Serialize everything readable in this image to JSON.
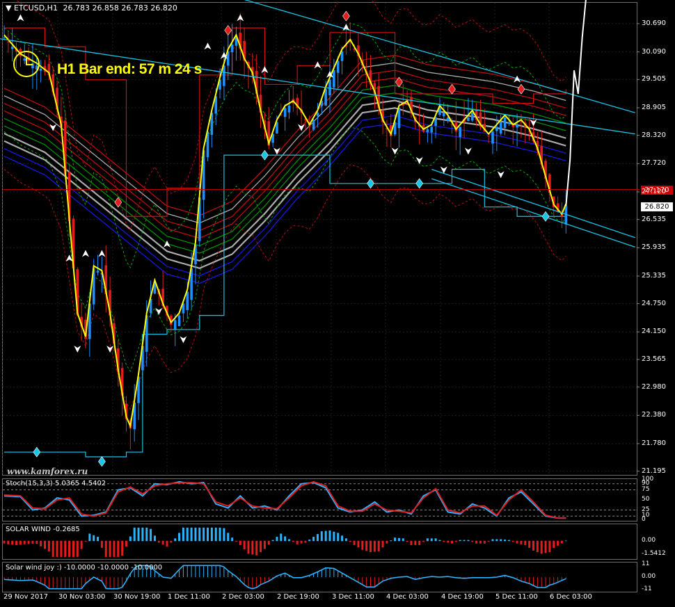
{
  "header": {
    "symbol_label": "ETCUSD,H1",
    "ohlc": "26.783 26.858 26.783 26.820"
  },
  "timer_text": "H1 Bar end: 57 m 24 s",
  "watermark": "www.kamforex.ru",
  "price_boxes": {
    "hline_price": "27.170",
    "current_price": "26.820"
  },
  "colors": {
    "background": "#000000",
    "bull": "#1e90ff",
    "bear": "#e41c1c",
    "signal_line": "#ffff00",
    "channel": "#19c6e6",
    "hline": "#cc0000",
    "ema_band": [
      "#1a1aff",
      "#c0c0c0",
      "#00a000",
      "#d01010"
    ]
  },
  "chart_data": [
    {
      "type": "candlestick",
      "title": "ETCUSD,H1",
      "y_ticks": [
        "30.690",
        "30.090",
        "29.505",
        "28.905",
        "28.320",
        "27.720",
        "27.120",
        "26.535",
        "25.935",
        "25.335",
        "24.750",
        "24.150",
        "23.565",
        "22.980",
        "22.380",
        "21.780",
        "21.195"
      ],
      "x_ticks": [
        "29 Nov 2017",
        "30 Nov 03:00",
        "30 Nov 19:00",
        "1 Dec 11:00",
        "2 Dec 03:00",
        "2 Dec 19:00",
        "3 Dec 11:00",
        "4 Dec 03:00",
        "4 Dec 19:00",
        "5 Dec 11:00",
        "6 Dec 03:00"
      ],
      "ylim": [
        21.0,
        31.0
      ],
      "close_path": [
        [
          0,
          30.4
        ],
        [
          4,
          30.0
        ],
        [
          8,
          29.8
        ],
        [
          11,
          29.6
        ],
        [
          14,
          28.5
        ],
        [
          16,
          26.5
        ],
        [
          18,
          24.5
        ],
        [
          20,
          24.0
        ],
        [
          22,
          25.5
        ],
        [
          24,
          25.4
        ],
        [
          26,
          24.5
        ],
        [
          28,
          23.3
        ],
        [
          30,
          22.3
        ],
        [
          31,
          22.1
        ],
        [
          33,
          23.2
        ],
        [
          35,
          24.5
        ],
        [
          37,
          25.2
        ],
        [
          39,
          24.7
        ],
        [
          41,
          24.3
        ],
        [
          43,
          24.5
        ],
        [
          45,
          25.0
        ],
        [
          47,
          26.0
        ],
        [
          49,
          28.0
        ],
        [
          51,
          28.8
        ],
        [
          53,
          29.5
        ],
        [
          55,
          30.1
        ],
        [
          57,
          30.4
        ],
        [
          59,
          29.9
        ],
        [
          61,
          29.6
        ],
        [
          63,
          28.8
        ],
        [
          65,
          28.1
        ],
        [
          67,
          28.6
        ],
        [
          69,
          28.9
        ],
        [
          71,
          29.0
        ],
        [
          73,
          28.8
        ],
        [
          75,
          28.5
        ],
        [
          77,
          28.8
        ],
        [
          79,
          29.3
        ],
        [
          81,
          29.7
        ],
        [
          83,
          30.1
        ],
        [
          85,
          30.3
        ],
        [
          87,
          30.0
        ],
        [
          89,
          29.6
        ],
        [
          91,
          29.2
        ],
        [
          93,
          28.6
        ],
        [
          95,
          28.3
        ],
        [
          97,
          28.9
        ],
        [
          99,
          29.0
        ],
        [
          101,
          28.6
        ],
        [
          103,
          28.4
        ],
        [
          105,
          28.5
        ],
        [
          107,
          28.9
        ],
        [
          109,
          28.7
        ],
        [
          111,
          28.4
        ],
        [
          113,
          28.6
        ],
        [
          115,
          28.8
        ],
        [
          117,
          28.5
        ],
        [
          119,
          28.3
        ],
        [
          121,
          28.5
        ],
        [
          123,
          28.7
        ],
        [
          125,
          28.5
        ],
        [
          127,
          28.6
        ],
        [
          129,
          28.4
        ],
        [
          131,
          28.0
        ],
        [
          133,
          27.4
        ],
        [
          135,
          26.8
        ],
        [
          137,
          26.6
        ],
        [
          138,
          26.82
        ]
      ],
      "ema_band_levels": [
        [
          0,
          28.6
        ],
        [
          10,
          28.2
        ],
        [
          20,
          27.5
        ],
        [
          30,
          26.8
        ],
        [
          40,
          26.1
        ],
        [
          48,
          25.9
        ],
        [
          56,
          26.2
        ],
        [
          64,
          26.9
        ],
        [
          72,
          27.7
        ],
        [
          80,
          28.4
        ],
        [
          88,
          29.2
        ],
        [
          96,
          29.3
        ],
        [
          104,
          29.1
        ],
        [
          112,
          29.0
        ],
        [
          120,
          28.9
        ],
        [
          130,
          28.7
        ],
        [
          138,
          28.5
        ]
      ],
      "channel_lines": [
        {
          "from": [
            -15,
            30.55
          ],
          "to": [
            155,
            28.35
          ]
        },
        {
          "from": [
            55,
            31.3
          ],
          "to": [
            155,
            28.8
          ]
        },
        {
          "from": [
            105,
            27.6
          ],
          "to": [
            155,
            26.15
          ]
        },
        {
          "from": [
            105,
            27.4
          ],
          "to": [
            155,
            25.95
          ]
        }
      ],
      "hline": 27.17,
      "projection": [
        [
          138,
          26.82
        ],
        [
          139,
          27.8
        ],
        [
          140,
          29.7
        ],
        [
          141,
          29.2
        ],
        [
          142,
          30.4
        ],
        [
          143,
          31.3
        ]
      ],
      "levels_upper": [
        [
          0,
          30.6
        ],
        [
          10,
          30.2
        ],
        [
          20,
          29.5
        ],
        [
          30,
          26.6
        ],
        [
          40,
          27.2
        ],
        [
          48,
          29.6
        ],
        [
          56,
          30.6
        ],
        [
          64,
          29.4
        ],
        [
          72,
          29.8
        ],
        [
          80,
          30.5
        ],
        [
          88,
          30.5
        ],
        [
          96,
          29.2
        ],
        [
          110,
          29.2
        ],
        [
          120,
          29.0
        ],
        [
          130,
          29.2
        ],
        [
          138,
          29.3
        ]
      ],
      "levels_lower": [
        [
          0,
          21.6
        ],
        [
          10,
          21.6
        ],
        [
          20,
          21.5
        ],
        [
          30,
          21.6
        ],
        [
          34,
          24.1
        ],
        [
          40,
          24.2
        ],
        [
          48,
          24.5
        ],
        [
          54,
          27.9
        ],
        [
          64,
          27.9
        ],
        [
          76,
          27.9
        ],
        [
          80,
          27.3
        ],
        [
          90,
          27.3
        ],
        [
          100,
          27.3
        ],
        [
          110,
          27.6
        ],
        [
          118,
          26.8
        ],
        [
          126,
          26.6
        ],
        [
          138,
          26.6
        ]
      ]
    },
    {
      "type": "line",
      "title": "Stoch(15,3,3) 5.0365 4.5402",
      "y_ticks": [
        "100",
        "90",
        "75",
        "50",
        "25",
        "10",
        "0"
      ],
      "ylim": [
        0,
        100
      ],
      "series": [
        {
          "name": "main",
          "values": [
            [
              0,
              60
            ],
            [
              4,
              58
            ],
            [
              7,
              25
            ],
            [
              10,
              30
            ],
            [
              13,
              55
            ],
            [
              16,
              50
            ],
            [
              19,
              10
            ],
            [
              22,
              12
            ],
            [
              25,
              20
            ],
            [
              28,
              75
            ],
            [
              31,
              80
            ],
            [
              34,
              60
            ],
            [
              37,
              90
            ],
            [
              40,
              88
            ],
            [
              43,
              95
            ],
            [
              46,
              90
            ],
            [
              49,
              93
            ],
            [
              52,
              40
            ],
            [
              55,
              30
            ],
            [
              58,
              60
            ],
            [
              61,
              30
            ],
            [
              64,
              35
            ],
            [
              67,
              25
            ],
            [
              70,
              60
            ],
            [
              73,
              90
            ],
            [
              76,
              93
            ],
            [
              79,
              80
            ],
            [
              82,
              30
            ],
            [
              85,
              20
            ],
            [
              88,
              25
            ],
            [
              91,
              45
            ],
            [
              94,
              20
            ],
            [
              97,
              25
            ],
            [
              100,
              15
            ],
            [
              103,
              60
            ],
            [
              106,
              75
            ],
            [
              109,
              20
            ],
            [
              112,
              15
            ],
            [
              115,
              40
            ],
            [
              118,
              30
            ],
            [
              121,
              10
            ],
            [
              124,
              55
            ],
            [
              127,
              70
            ],
            [
              130,
              40
            ],
            [
              133,
              10
            ],
            [
              136,
              5
            ],
            [
              138,
              5
            ]
          ]
        },
        {
          "name": "signal",
          "values": [
            [
              0,
              62
            ],
            [
              4,
              60
            ],
            [
              7,
              30
            ],
            [
              10,
              28
            ],
            [
              13,
              50
            ],
            [
              16,
              55
            ],
            [
              19,
              15
            ],
            [
              22,
              10
            ],
            [
              25,
              18
            ],
            [
              28,
              70
            ],
            [
              31,
              82
            ],
            [
              34,
              65
            ],
            [
              37,
              85
            ],
            [
              40,
              90
            ],
            [
              43,
              92
            ],
            [
              46,
              93
            ],
            [
              49,
              90
            ],
            [
              52,
              45
            ],
            [
              55,
              35
            ],
            [
              58,
              55
            ],
            [
              61,
              35
            ],
            [
              64,
              30
            ],
            [
              67,
              28
            ],
            [
              70,
              55
            ],
            [
              73,
              85
            ],
            [
              76,
              95
            ],
            [
              79,
              85
            ],
            [
              82,
              35
            ],
            [
              85,
              22
            ],
            [
              88,
              22
            ],
            [
              91,
              40
            ],
            [
              94,
              25
            ],
            [
              97,
              22
            ],
            [
              100,
              18
            ],
            [
              103,
              55
            ],
            [
              106,
              78
            ],
            [
              109,
              25
            ],
            [
              112,
              18
            ],
            [
              115,
              35
            ],
            [
              118,
              35
            ],
            [
              121,
              12
            ],
            [
              124,
              50
            ],
            [
              127,
              75
            ],
            [
              130,
              45
            ],
            [
              133,
              12
            ],
            [
              136,
              5
            ],
            [
              138,
              4.5
            ]
          ]
        }
      ]
    },
    {
      "type": "bar",
      "title": "SOLAR WIND -0.2685",
      "y_ticks": [
        "0.00",
        "-1.5412"
      ],
      "ylim": [
        -2.0,
        1.8
      ]
    },
    {
      "type": "bar",
      "title": "Solar wind joy :) -10.0000 -10.0000 -10.0000",
      "y_ticks": [
        "11",
        "0.00",
        "-11"
      ],
      "ylim": [
        -12,
        12
      ]
    }
  ]
}
